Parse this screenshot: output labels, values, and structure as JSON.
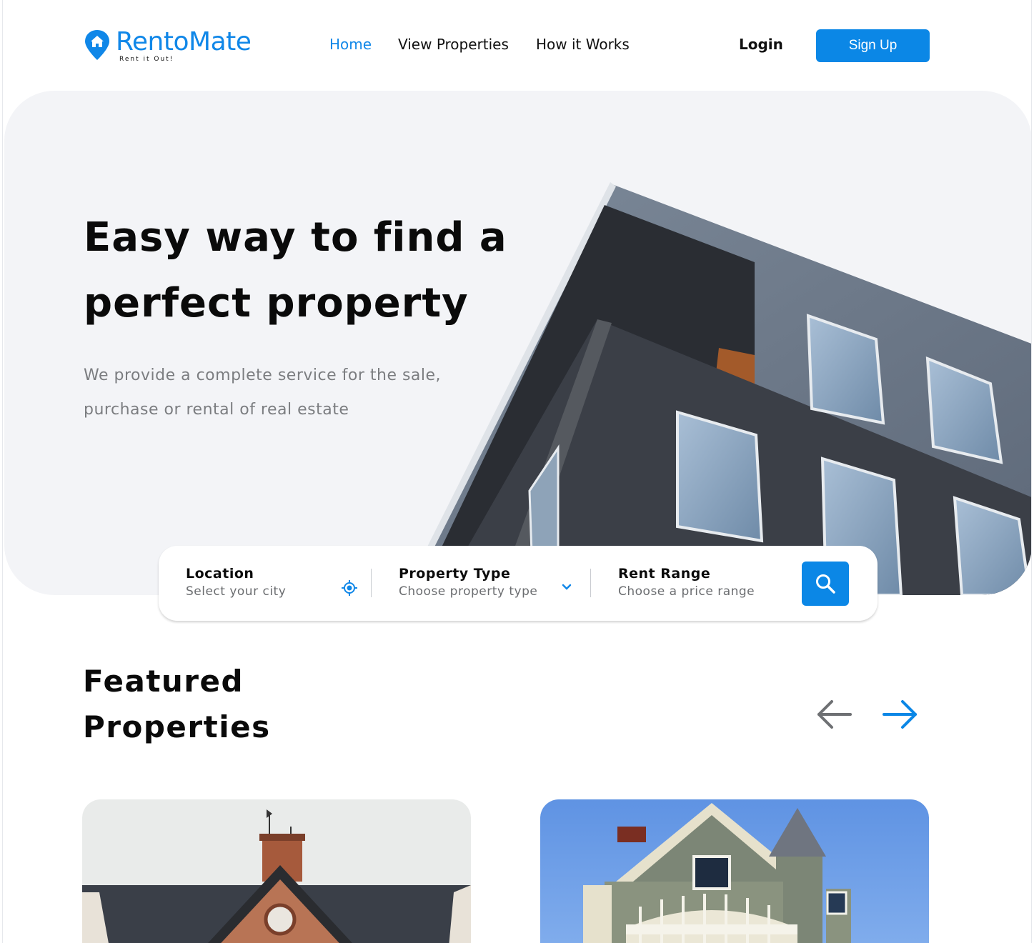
{
  "brand": {
    "name": "RentoMate",
    "tagline": "Rent it Out!",
    "color": "#1087e8"
  },
  "nav": {
    "links": [
      {
        "label": "Home",
        "active": true
      },
      {
        "label": "View Properties",
        "active": false
      },
      {
        "label": "How it Works",
        "active": false
      }
    ],
    "login_label": "Login",
    "signup_label": "Sign Up"
  },
  "hero": {
    "title_line1": "Easy way to find a",
    "title_line2": "perfect property",
    "subtitle_line1": "We provide a complete service for the sale,",
    "subtitle_line2": "purchase or rental of real estate"
  },
  "search": {
    "location": {
      "label": "Location",
      "hint": "Select your city",
      "icon": "locate-icon"
    },
    "property_type": {
      "label": "Property Type",
      "hint": "Choose property type",
      "icon": "chevron-down-icon"
    },
    "rent_range": {
      "label": "Rent Range",
      "hint": "Choose a price range"
    },
    "button_icon": "search-icon"
  },
  "featured": {
    "title_line1": "Featured",
    "title_line2": "Properties",
    "prev_icon": "arrow-left-icon",
    "next_icon": "arrow-right-icon",
    "accent": "#0b87e6"
  }
}
